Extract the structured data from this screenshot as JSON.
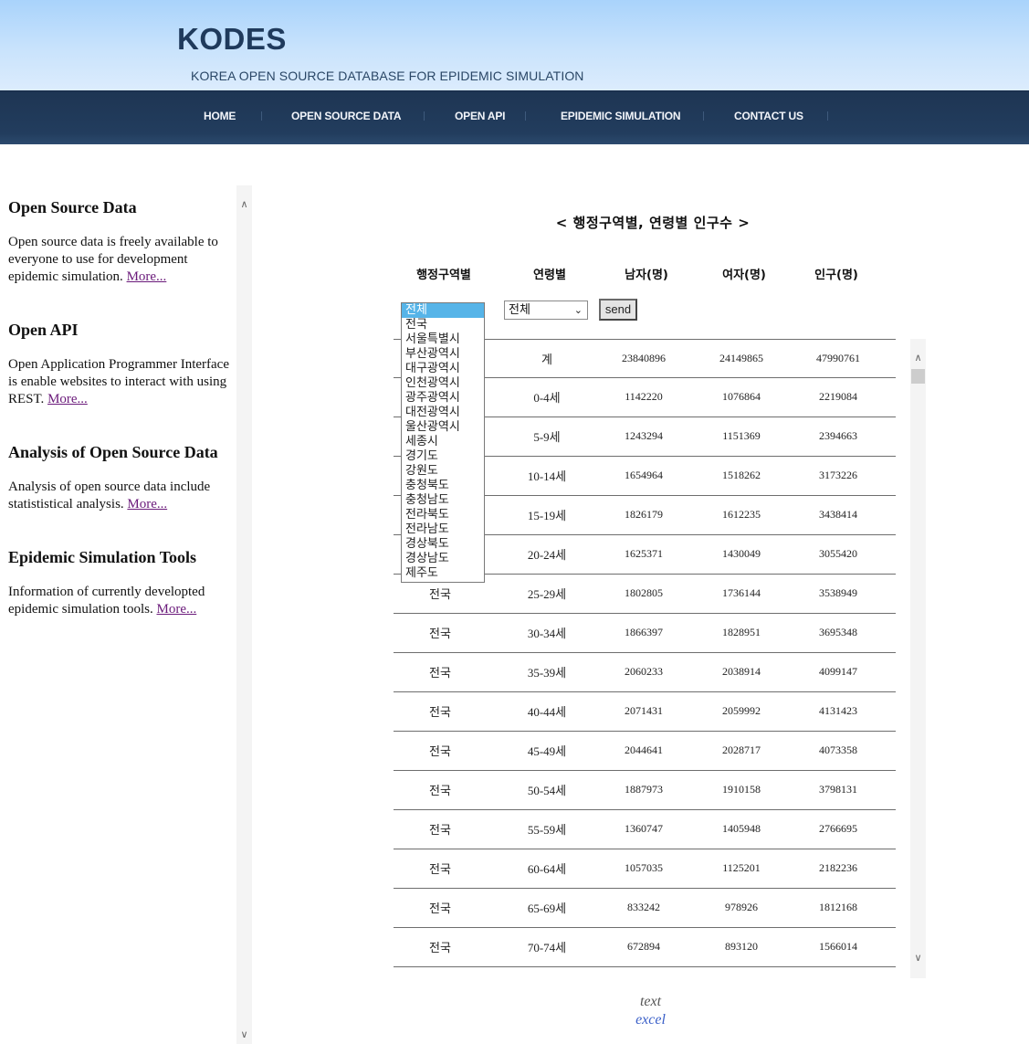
{
  "header": {
    "logo": "KODES",
    "tagline": "KOREA OPEN SOURCE DATABASE FOR EPIDEMIC SIMULATION"
  },
  "nav": {
    "items": [
      {
        "label": "HOME"
      },
      {
        "label": "OPEN SOURCE DATA"
      },
      {
        "label": "OPEN API"
      },
      {
        "label": "EPIDEMIC SIMULATION"
      },
      {
        "label": "CONTACT US"
      }
    ]
  },
  "sidebar": {
    "sections": [
      {
        "title": "Open Source Data",
        "text": "Open source data is freely available to everyone to use for development epidemic simulation.",
        "link": "More..."
      },
      {
        "title": "Open API",
        "text": "Open Application Programmer Interface is enable websites to interact with using REST.",
        "link": "More..."
      },
      {
        "title": "Analysis of Open Source Data",
        "text": "Analysis of open source data include statististical analysis.",
        "link": "More..."
      },
      {
        "title": "Epidemic Simulation Tools",
        "text": "Information of currently developted epidemic simulation tools.",
        "link": "More..."
      }
    ]
  },
  "main": {
    "title": "< 행정구역별, 연령별 인구수 >",
    "columns": [
      "행정구역별",
      "연령별",
      "남자(명)",
      "여자(명)",
      "인구(명)"
    ],
    "region_select": {
      "selected": "전체",
      "options": [
        "전체",
        "전국",
        "서울특별시",
        "부산광역시",
        "대구광역시",
        "인천광역시",
        "광주광역시",
        "대전광역시",
        "울산광역시",
        "세종시",
        "경기도",
        "강원도",
        "충청북도",
        "충청남도",
        "전라북도",
        "전라남도",
        "경상북도",
        "경상남도",
        "제주도"
      ]
    },
    "age_select": {
      "selected": "전체"
    },
    "send_label": "send",
    "rows": [
      {
        "region": "",
        "age": "계",
        "male": "23840896",
        "female": "24149865",
        "total": "47990761"
      },
      {
        "region": "",
        "age": "0-4세",
        "male": "1142220",
        "female": "1076864",
        "total": "2219084"
      },
      {
        "region": "",
        "age": "5-9세",
        "male": "1243294",
        "female": "1151369",
        "total": "2394663"
      },
      {
        "region": "",
        "age": "10-14세",
        "male": "1654964",
        "female": "1518262",
        "total": "3173226"
      },
      {
        "region": "",
        "age": "15-19세",
        "male": "1826179",
        "female": "1612235",
        "total": "3438414"
      },
      {
        "region": "",
        "age": "20-24세",
        "male": "1625371",
        "female": "1430049",
        "total": "3055420"
      },
      {
        "region": "전국",
        "age": "25-29세",
        "male": "1802805",
        "female": "1736144",
        "total": "3538949"
      },
      {
        "region": "전국",
        "age": "30-34세",
        "male": "1866397",
        "female": "1828951",
        "total": "3695348"
      },
      {
        "region": "전국",
        "age": "35-39세",
        "male": "2060233",
        "female": "2038914",
        "total": "4099147"
      },
      {
        "region": "전국",
        "age": "40-44세",
        "male": "2071431",
        "female": "2059992",
        "total": "4131423"
      },
      {
        "region": "전국",
        "age": "45-49세",
        "male": "2044641",
        "female": "2028717",
        "total": "4073358"
      },
      {
        "region": "전국",
        "age": "50-54세",
        "male": "1887973",
        "female": "1910158",
        "total": "3798131"
      },
      {
        "region": "전국",
        "age": "55-59세",
        "male": "1360747",
        "female": "1405948",
        "total": "2766695"
      },
      {
        "region": "전국",
        "age": "60-64세",
        "male": "1057035",
        "female": "1125201",
        "total": "2182236"
      },
      {
        "region": "전국",
        "age": "65-69세",
        "male": "833242",
        "female": "978926",
        "total": "1812168"
      },
      {
        "region": "전국",
        "age": "70-74세",
        "male": "672894",
        "female": "893120",
        "total": "1566014"
      }
    ],
    "downloads": {
      "text": "text",
      "excel": "excel"
    }
  },
  "icons": {
    "scroll_up": "chevron-up-icon",
    "scroll_down": "chevron-down-icon",
    "select_arrow": "chevron-down-icon"
  }
}
